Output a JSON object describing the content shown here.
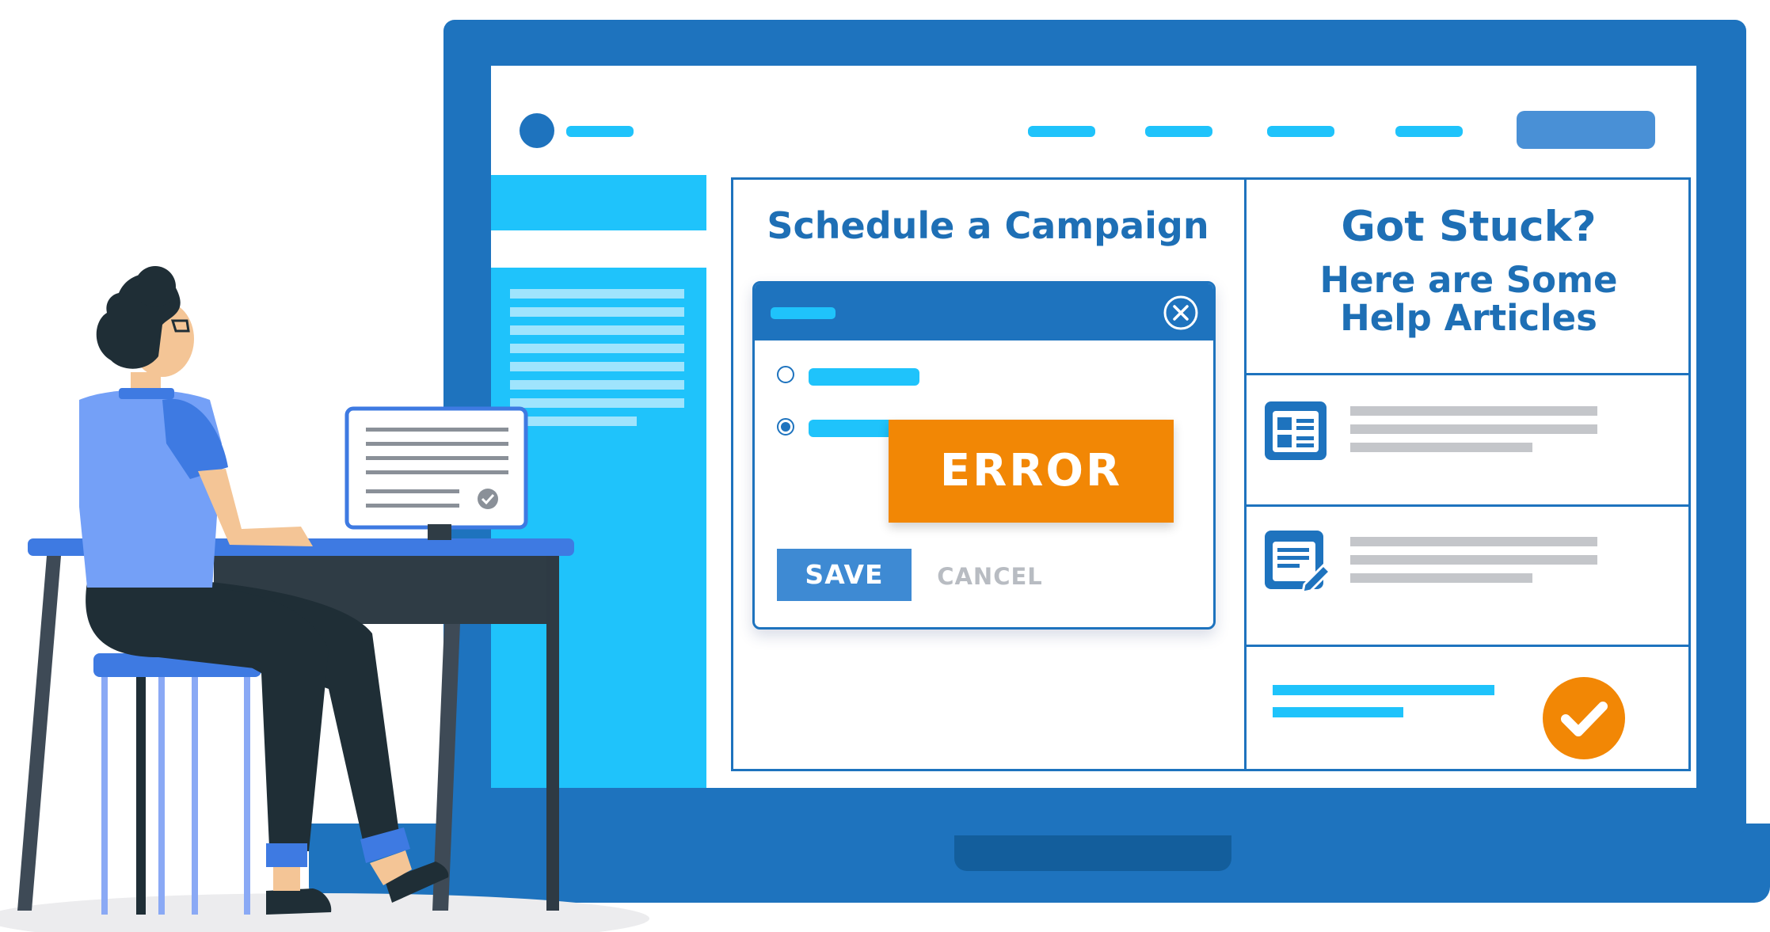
{
  "main": {
    "title": "Schedule a Campaign"
  },
  "dialog": {
    "error_label": "ERROR",
    "save_label": "SAVE",
    "cancel_label": "CANCEL"
  },
  "help": {
    "title": "Got Stuck?",
    "subtitle_line1": "Here are Some",
    "subtitle_line2": "Help Articles"
  },
  "colors": {
    "primary_blue": "#1e73be",
    "cyan": "#1fc3fb",
    "orange": "#f28705",
    "heading_blue": "#1e6fb5"
  },
  "icons": [
    "close-icon",
    "article-list-icon",
    "edit-document-icon",
    "checkmark-icon"
  ]
}
